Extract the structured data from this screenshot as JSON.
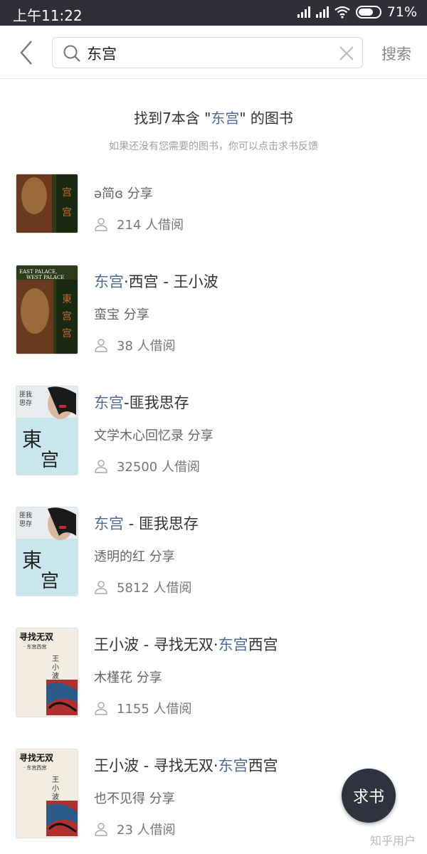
{
  "status_bar": {
    "time": "上午11:22",
    "battery": "71%"
  },
  "search": {
    "query": "东宫",
    "button_label": "搜索"
  },
  "summary": {
    "prefix": "找到7本含 \"",
    "keyword": "东宫",
    "suffix": "\" 的图书",
    "hint": "如果还没有您需要的图书，你可以点击求书反馈"
  },
  "books": [
    {
      "title_pre": "",
      "title_hl": "",
      "title_post": "",
      "sharer": "ə简ɞ 分享",
      "borrow": "214 人借阅"
    },
    {
      "title_pre": "",
      "title_hl": "东宫",
      "title_post": "·西宫 - 王小波",
      "sharer": "蛮宝 分享",
      "borrow": "38 人借阅",
      "cover_text": "EAST PALACE, WEST PALACE"
    },
    {
      "title_pre": "",
      "title_hl": "东宫",
      "title_post": "-匪我思存",
      "sharer": "文学木心回忆录 分享",
      "borrow": "32500 人借阅"
    },
    {
      "title_pre": "",
      "title_hl": "东宫",
      "title_post": " - 匪我思存",
      "sharer": "透明的红 分享",
      "borrow": "5812 人借阅"
    },
    {
      "title_pre": "王小波 - 寻找无双·",
      "title_hl": "东宫",
      "title_post": "西宫",
      "sharer": "木槿花 分享",
      "borrow": "1155 人借阅",
      "cover_text": "寻找无双"
    },
    {
      "title_pre": "王小波 - 寻找无双·",
      "title_hl": "东宫",
      "title_post": "西宫",
      "sharer": "也不见得 分享",
      "borrow": "23 人借阅",
      "cover_text": "寻找无双"
    }
  ],
  "fab_label": "求书",
  "watermark": "知乎用户"
}
